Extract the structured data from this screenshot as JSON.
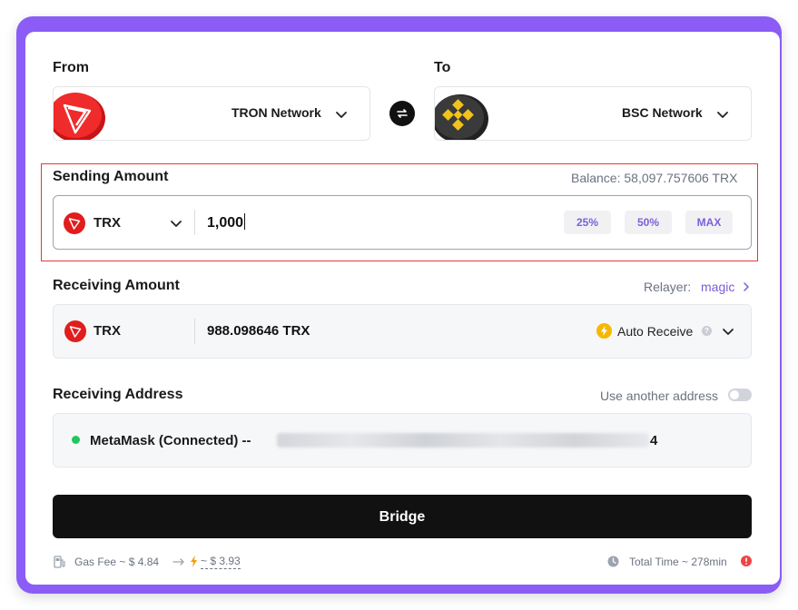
{
  "from": {
    "label": "From",
    "network": "TRON Network"
  },
  "to": {
    "label": "To",
    "network": "BSC Network"
  },
  "sending": {
    "label": "Sending Amount",
    "balance": "Balance: 58,097.757606 TRX",
    "token": "TRX",
    "amount": "1,000",
    "pct_buttons": [
      "25%",
      "50%",
      "MAX"
    ]
  },
  "receiving": {
    "label": "Receiving Amount",
    "relayer_label": "Relayer:",
    "relayer_name": "magic",
    "token": "TRX",
    "amount": "988.098646 TRX",
    "auto_receive": "Auto Receive",
    "help_glyph": "?"
  },
  "address": {
    "label": "Receiving Address",
    "use_another": "Use another address",
    "wallet": "MetaMask (Connected) --",
    "address_suffix": "4",
    "use_another_enabled": false
  },
  "bridge_label": "Bridge",
  "footer": {
    "gas_fee": "Gas Fee ~ $ 4.84",
    "gas_fee_discount": "~ $ 3.93",
    "total_time": "Total Time ~ 278min"
  },
  "colors": {
    "accent": "#8b5cf6",
    "tron_red": "#e11d1d",
    "connected_green": "#22c55e",
    "alert_red": "#ef4444",
    "bolt_yellow": "#f5b800"
  },
  "icons": [
    "tron-logo",
    "bnb-logo",
    "swap-icon",
    "chevron-down-icon",
    "lightning-icon",
    "help-icon",
    "gas-pump-icon",
    "arrow-right-icon",
    "clock-icon",
    "alert-icon",
    "chevron-right-icon"
  ]
}
